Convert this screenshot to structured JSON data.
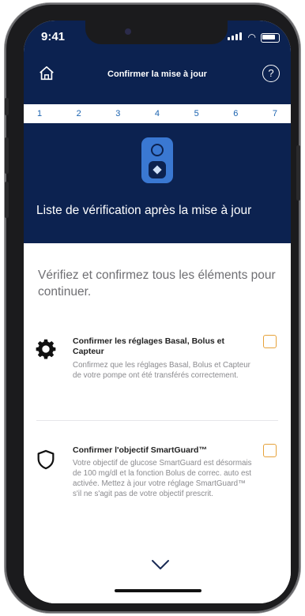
{
  "status": {
    "time": "9:41"
  },
  "header": {
    "title": "Confirmer la mise à jour"
  },
  "steps": [
    "1",
    "2",
    "3",
    "4",
    "5",
    "6",
    "7"
  ],
  "banner": {
    "title": "Liste de vérification après la mise à jour"
  },
  "intro": "Vérifiez et confirmez tous les éléments pour continuer.",
  "items": [
    {
      "title": "Confirmer les réglages Basal, Bolus et Capteur",
      "description": "Confirmez que les réglages Basal, Bolus et Capteur de votre pompe ont été transférés correctement.",
      "icon": "gear-icon",
      "checked": false
    },
    {
      "title": "Confirmer l'objectif SmartGuard™",
      "description": "Votre objectif de glucose SmartGuard est désormais de 100 mg/dl et la fonction Bolus de correc. auto est activée. Mettez à jour votre réglage SmartGuard™ s'il ne s'agit pas de votre objectif prescrit.",
      "icon": "shield-icon",
      "checked": false
    }
  ],
  "colors": {
    "header_bg": "#0c2250",
    "step_text": "#1b63b0",
    "checkbox_border": "#e6a23a",
    "device_blue": "#3a78d2"
  }
}
